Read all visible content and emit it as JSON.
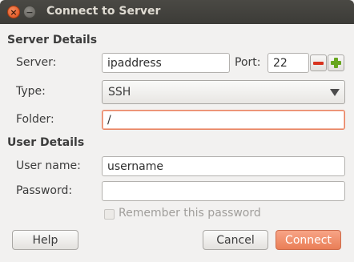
{
  "window": {
    "title": "Connect to Server",
    "close_glyph": "×",
    "minimize_glyph": "−"
  },
  "server_details": {
    "heading": "Server Details",
    "server_label": "Server:",
    "server_value": "ipaddress",
    "port_label": "Port:",
    "port_value": "22",
    "type_label": "Type:",
    "type_value": "SSH",
    "folder_label": "Folder:",
    "folder_value": "/"
  },
  "user_details": {
    "heading": "User Details",
    "username_label": "User name:",
    "username_value": "username",
    "password_label": "Password:",
    "password_value": "",
    "remember_label": "Remember this password",
    "remember_checked": false
  },
  "buttons": {
    "help": "Help",
    "cancel": "Cancel",
    "connect": "Connect"
  },
  "colors": {
    "accent": "#ea7e57",
    "titlebar": "#3c3b37",
    "focus_border": "#e8815f"
  }
}
